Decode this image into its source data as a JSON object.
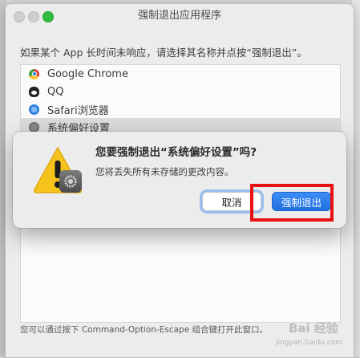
{
  "window": {
    "title": "强制退出应用程序",
    "instruction": "如果某个 App 长时间未响应，请选择其名称并点按“强制退出”。",
    "apps": [
      {
        "label": "Google Chrome",
        "icon": "chrome-icon"
      },
      {
        "label": "QQ",
        "icon": "qq-icon"
      },
      {
        "label": "Safari浏览器",
        "icon": "safari-icon"
      },
      {
        "label": "系统偏好设置",
        "icon": "system-preferences-icon",
        "selected": true
      }
    ],
    "footer": "您可以通过按下 Command-Option-Escape 组合键打开此窗口。"
  },
  "dialog": {
    "title": "您要强制退出“系统偏好设置”吗?",
    "message": "您将丢失所有未存储的更改内容。",
    "cancel_label": "取消",
    "force_quit_label": "强制退出"
  },
  "watermark": {
    "brand": "Bai 经验",
    "url": "jingyan.baidu.com"
  },
  "colors": {
    "accent": "#2a7cf0",
    "highlight": "#e81010"
  }
}
